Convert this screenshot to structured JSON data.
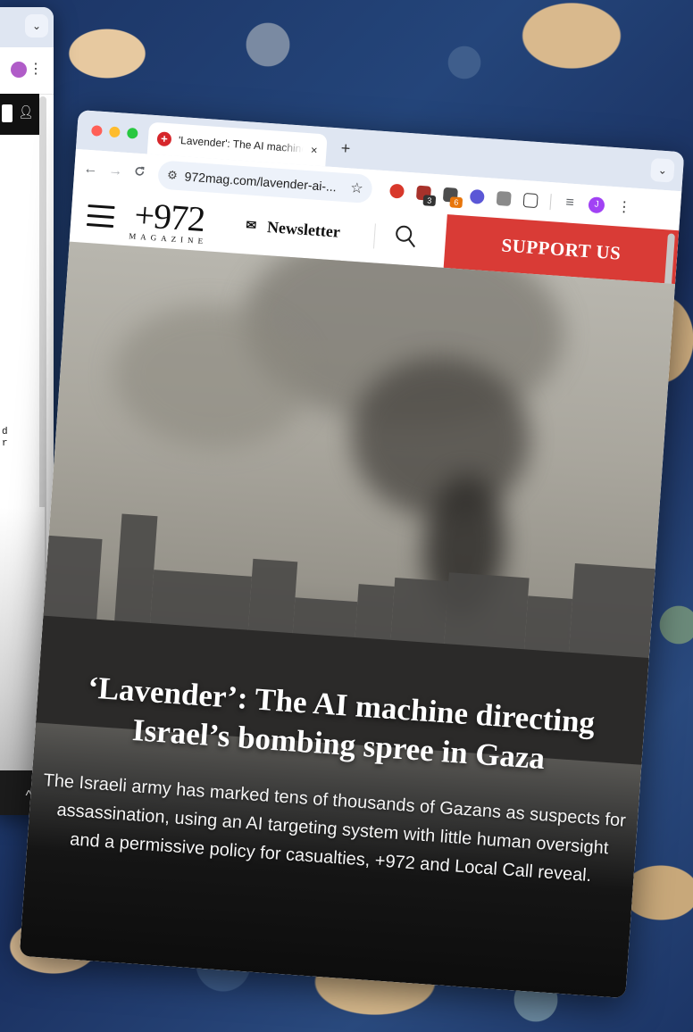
{
  "back_window": {
    "dropdown_icon": "chevron-down-icon",
    "menu_icon": "kebab-icon",
    "profile_color": "#b05cc8",
    "scroll_up_icon": "chevron-up-icon"
  },
  "tab": {
    "title": "'Lavender': The AI machine directing",
    "close": "×",
    "new_tab": "+"
  },
  "toolbar": {
    "back": "←",
    "forward": "→",
    "reload": "C",
    "url": "972mag.com/lavender-ai-...",
    "extensions": [
      {
        "name": "s-extension",
        "color": "#d8382b",
        "badge": ""
      },
      {
        "name": "shield-extension",
        "color": "#a8322b",
        "badge": "3",
        "badge_color": "#333333"
      },
      {
        "name": "feather-extension",
        "color": "#4d4d4d",
        "badge": "6",
        "badge_color": "#e8750a"
      },
      {
        "name": "rainbow-extension",
        "color": "#5b57d6",
        "badge": ""
      },
      {
        "name": "book-extension",
        "color": "#8a8a8a",
        "badge": ""
      },
      {
        "name": "puzzle-extension",
        "color": "#ffffff",
        "badge": ""
      }
    ],
    "profile_initial": "J"
  },
  "site": {
    "logo_number": "+972",
    "logo_sub": "MAGAZINE",
    "newsletter": "Newsletter",
    "support": "SUPPORT US",
    "accent": "#d93b36"
  },
  "article": {
    "headline_line1": "‘Lavender’: The AI machine directing",
    "headline_line2": "Israel’s bombing spree in Gaza",
    "dek_line1": "The Israeli army has marked tens of thousands of Gazans as suspects for",
    "dek_line2": "assassination, using an AI targeting system with little human oversight",
    "dek_line3": "and a permissive policy for casualties, +972 and Local Call reveal."
  }
}
